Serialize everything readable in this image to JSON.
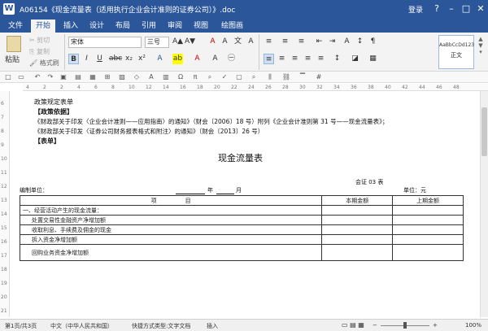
{
  "window": {
    "title": "A06154《现金流量表（适用执行企业会计准则的证券公司）》.doc",
    "login": "登录",
    "controls": [
      "?",
      "–",
      "□",
      "✕"
    ]
  },
  "menu": {
    "tabs": [
      "文件",
      "开始",
      "插入",
      "设计",
      "布局",
      "引用",
      "审阅",
      "视图",
      "绘图画"
    ],
    "active_tab": "开始"
  },
  "ribbon": {
    "paste": "粘贴",
    "cut": "剪切",
    "copy": "复制",
    "format_painter": "格式刷",
    "font_name": "宋体",
    "font_size": "三号",
    "style_preview": "AaBbCcDd123",
    "style_name": "正文"
  },
  "document": {
    "lines": [
      "政策规定表单",
      "【政策依据】",
      "《财政部关于印发〈企业会计准则——应用指南〉的通知》（财会〔2006〕18 号）附列《企业会计准则第 31 号——现金流量表》；",
      "《财政部关于印发〈证券公司财务报表格式和附注〉的通知》（财会〔2013〕26 号）",
      "【表单】"
    ],
    "report_title": "现金流量表",
    "form_code": "会证 03 表",
    "unit_label": "编制单位：",
    "year_label": "年",
    "month_label": "月",
    "currency_label": "单位：元",
    "table": {
      "headers": [
        "项　　　　　目",
        "本期金额",
        "上期金额"
      ],
      "rows": [
        "一、经营活动产生的现金流量：",
        "处置交易性金融资产净增加额",
        "收取利息、手续费及佣金的现金",
        "拆入资金净增加额",
        "回购业务资金净增加额"
      ]
    }
  },
  "ruler": {
    "vertical_numbers": [
      "6",
      "7",
      "8",
      "9",
      "10",
      "11",
      "12",
      "13",
      "14",
      "15",
      "16",
      "17",
      "18",
      "19",
      "20",
      "21"
    ],
    "horizontal_numbers": [
      "4",
      "2",
      "2",
      "4",
      "6",
      "8",
      "10",
      "12",
      "14",
      "16",
      "18",
      "20",
      "22",
      "24",
      "26",
      "28",
      "30",
      "32",
      "34",
      "36",
      "38",
      "40",
      "42",
      "44",
      "46",
      "48"
    ]
  },
  "status": {
    "page": "第1页/共3页",
    "language": "中文（中华人民共和国）",
    "mode": "快捷方式类型:文字文档",
    "insert": "插入",
    "zoom": "100%"
  }
}
